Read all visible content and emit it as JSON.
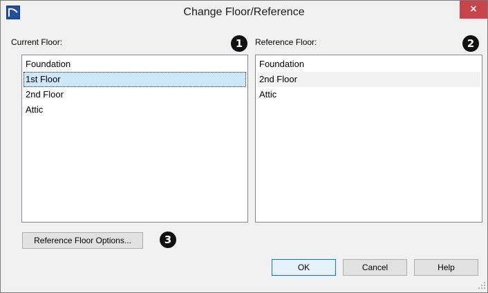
{
  "window": {
    "title": "Change Floor/Reference",
    "close_symbol": "×"
  },
  "current_floor": {
    "label": "Current Floor:",
    "items": [
      "Foundation",
      "1st Floor",
      "2nd Floor",
      "Attic"
    ],
    "selected": "1st Floor"
  },
  "reference_floor": {
    "label": "Reference Floor:",
    "items": [
      "Foundation",
      "2nd Floor",
      "Attic"
    ],
    "selected": "2nd Floor"
  },
  "callouts": [
    "1",
    "2",
    "3"
  ],
  "buttons": {
    "reference_floor_options": "Reference Floor Options...",
    "ok": "OK",
    "cancel": "Cancel",
    "help": "Help"
  },
  "colors": {
    "close_button": "#c9434a",
    "selection": "#cce8ff",
    "app_icon": "#1f4e9c"
  }
}
